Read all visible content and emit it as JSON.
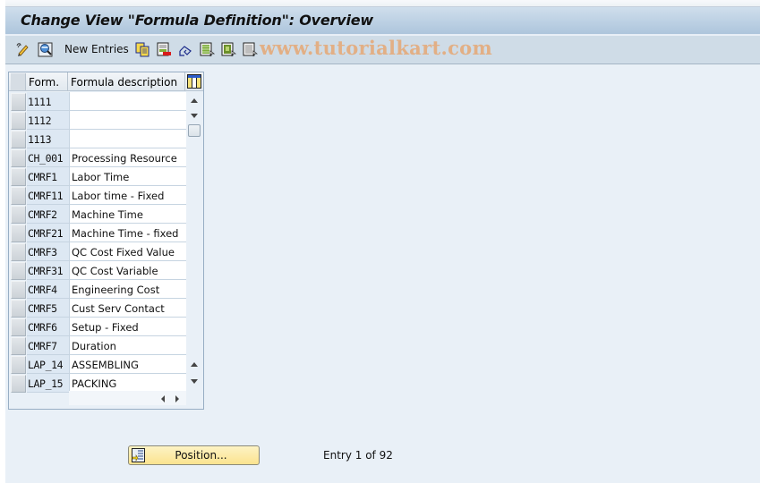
{
  "window": {
    "title": "Change View \"Formula Definition\": Overview",
    "watermark": "www.tutorialkart.com"
  },
  "toolbar": {
    "icons": [
      {
        "name": "display-change-icon",
        "tooltip": "Display -> Change"
      },
      {
        "name": "find-icon",
        "tooltip": "Find"
      },
      {
        "name": "copy-as-icon",
        "tooltip": "Copy As..."
      },
      {
        "name": "delete-icon",
        "tooltip": "Delete"
      },
      {
        "name": "undo-change-icon",
        "tooltip": "Undo Change"
      },
      {
        "name": "select-all-icon",
        "tooltip": "Select All"
      },
      {
        "name": "select-block-icon",
        "tooltip": "Select Block"
      },
      {
        "name": "deselect-all-icon",
        "tooltip": "Deselect All"
      }
    ],
    "new_entries_label": "New Entries"
  },
  "table": {
    "columns": [
      "Form.",
      "Formula description"
    ],
    "rows": [
      {
        "key": "1111",
        "desc": ""
      },
      {
        "key": "1112",
        "desc": ""
      },
      {
        "key": "1113",
        "desc": ""
      },
      {
        "key": "CH_001",
        "desc": "Processing Resource"
      },
      {
        "key": "CMRF1",
        "desc": "Labor Time"
      },
      {
        "key": "CMRF11",
        "desc": "Labor time - Fixed"
      },
      {
        "key": "CMRF2",
        "desc": "Machine Time"
      },
      {
        "key": "CMRF21",
        "desc": "Machine Time - fixed"
      },
      {
        "key": "CMRF3",
        "desc": "QC Cost Fixed Value"
      },
      {
        "key": "CMRF31",
        "desc": "QC Cost Variable"
      },
      {
        "key": "CMRF4",
        "desc": "Engineering Cost"
      },
      {
        "key": "CMRF5",
        "desc": "Cust Serv Contact"
      },
      {
        "key": "CMRF6",
        "desc": "Setup - Fixed"
      },
      {
        "key": "CMRF7",
        "desc": "Duration"
      },
      {
        "key": "LAP_14",
        "desc": "ASSEMBLING"
      },
      {
        "key": "LAP_15",
        "desc": "PACKING"
      }
    ]
  },
  "footer": {
    "position_button_label": "Position...",
    "entry_info": "Entry 1 of 92"
  },
  "colors": {
    "title_bar_top": "#cfdeec",
    "title_bar_bottom": "#adc5dc",
    "toolbar_bg": "#cfdce7",
    "canvas_bg": "#e9f0f7",
    "key_column_bg": "#dde8f3",
    "position_button_bg": "#fbe38f"
  }
}
